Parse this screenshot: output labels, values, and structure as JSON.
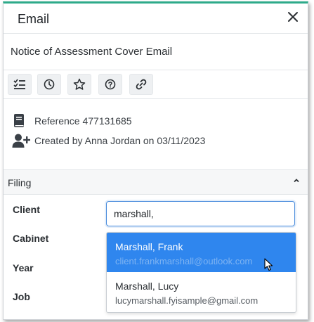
{
  "header": {
    "title": "Email"
  },
  "subject": "Notice of Assessment Cover Email",
  "toolbar": {
    "buttons": [
      "checklist-icon",
      "clock-icon",
      "star-icon",
      "question-icon",
      "link-icon"
    ]
  },
  "info": {
    "reference": "Reference 477131685",
    "created": "Created by Anna Jordan on 03/11/2023"
  },
  "filing": {
    "title": "Filing",
    "labels": {
      "client": "Client",
      "cabinet": "Cabinet",
      "year": "Year",
      "job": "Job"
    },
    "client_value": "marshall,"
  },
  "dropdown": {
    "options": [
      {
        "name": "Marshall, Frank",
        "email": "client.frankmarshall@outlook.com"
      },
      {
        "name": "Marshall, Lucy",
        "email": "lucymarshall.fyisample@gmail.com"
      }
    ]
  },
  "colors": {
    "accent": "#2eaa8a",
    "selection": "#2f86ee",
    "focus": "#4a8cdc"
  }
}
